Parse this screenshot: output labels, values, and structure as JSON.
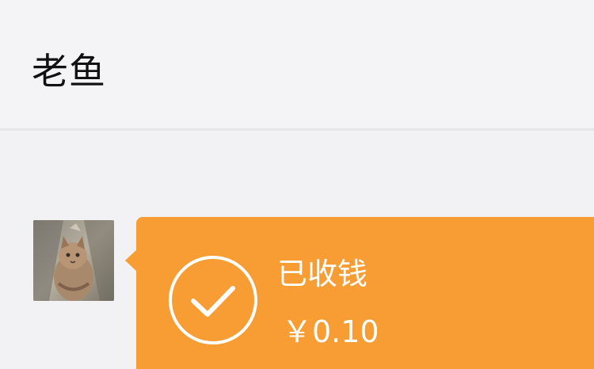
{
  "header": {
    "title": "老鱼"
  },
  "message": {
    "status": "已收钱",
    "amount": "￥0.10",
    "icon": "check-circle-icon",
    "bubble_color": "#f79d33"
  },
  "avatar": {
    "icon": "cat-avatar"
  }
}
